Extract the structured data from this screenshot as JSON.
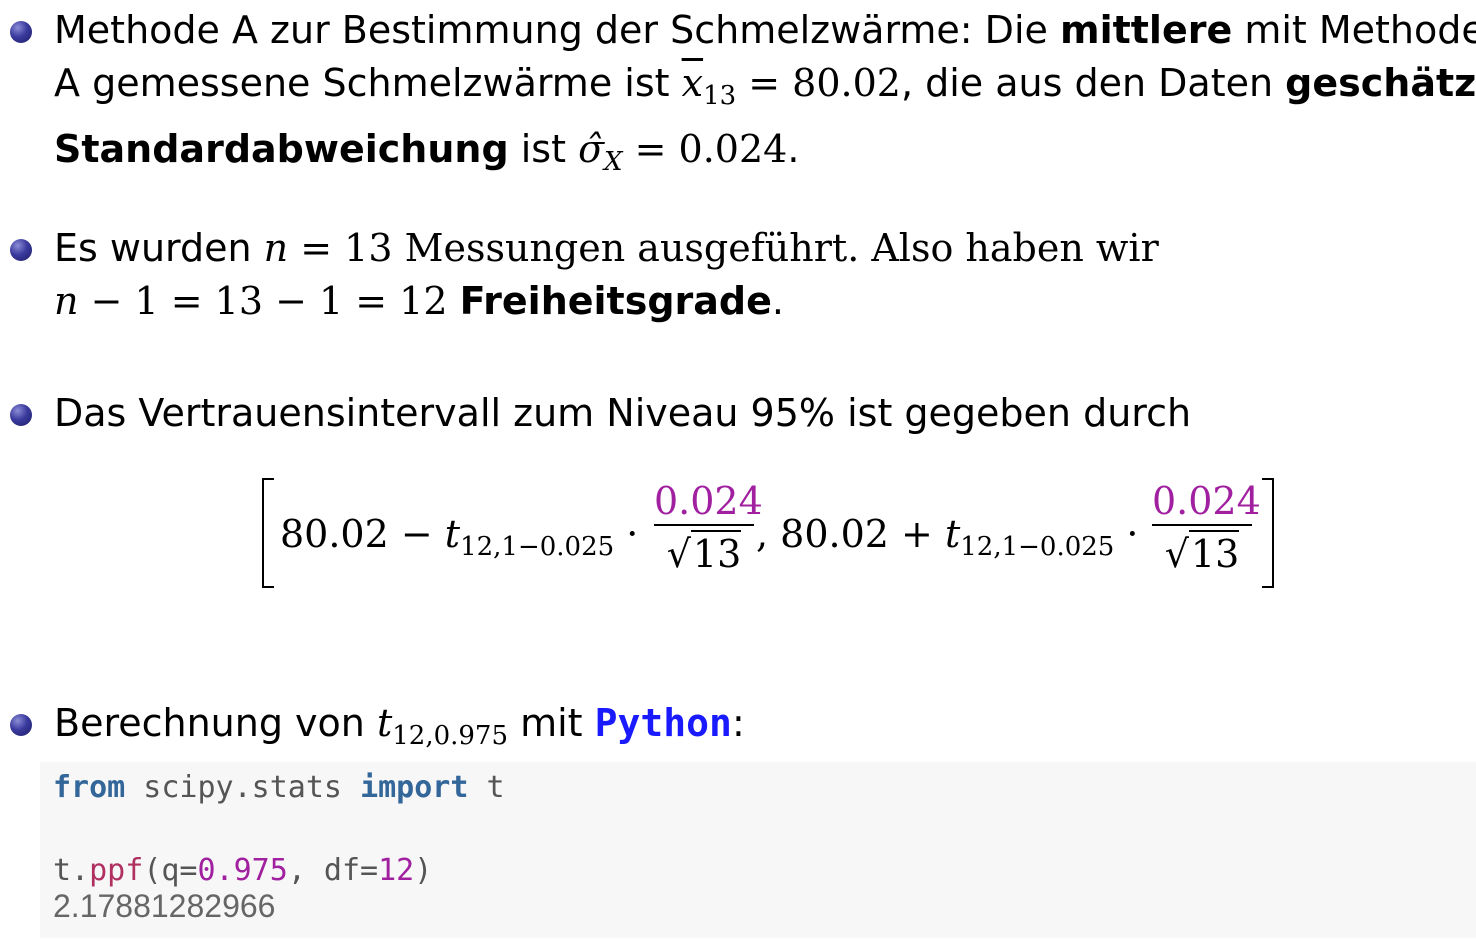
{
  "bullets": {
    "b1": {
      "pre": "Methode A zur Bestimmung der Schmelzwärme: Die ",
      "bold1": "mittlere",
      "mid1": " mit Methode",
      "line2_pre": "A gemessene Schmelzwärme ist ",
      "xbar": "x",
      "xbar_sub": "13",
      "xbar_eq": " = 80.02",
      "line2_mid": ", die aus den Daten ",
      "bold2": "geschätzte",
      "bold3": "Standardabweichung",
      "line3_mid": " ist ",
      "sigma": "σ̂",
      "sigma_sub": "X",
      "sigma_eq": " = 0.024",
      "line3_end": "."
    },
    "b2": {
      "pre": "Es wurden ",
      "n": "n",
      "eq": " = 13 Messungen ausgeführt. Also haben wir",
      "line2_n": "n",
      "line2_eq": " − 1 = 13 − 1 = 12 ",
      "bold": "Freiheitsgrade",
      "end": "."
    },
    "b3": {
      "text": "Das Vertrauensintervall zum Niveau 95% ist gegeben durch"
    },
    "b4": {
      "pre": "Berechnung von ",
      "t": "t",
      "t_sub": "12,0.975",
      "mid": " mit ",
      "python": "Python",
      "end": ":"
    }
  },
  "formula": {
    "left_value": "80.02 − ",
    "plus_value": ", 80.02 + ",
    "t": "t",
    "t_sub": "12,1−0.025",
    "dot": " ·",
    "numerator": "0.024",
    "sqrt_sign": "√",
    "denominator": "13"
  },
  "code": {
    "line1": {
      "kw1": "from",
      "mod": " scipy.stats ",
      "kw2": "import",
      "name": " t"
    },
    "line3": {
      "obj": "t.",
      "fn": "ppf",
      "open": "(q=",
      "q": "0.975",
      "sep": ", df=",
      "df": "12",
      "close": ")"
    },
    "output": "2.17881282966"
  }
}
